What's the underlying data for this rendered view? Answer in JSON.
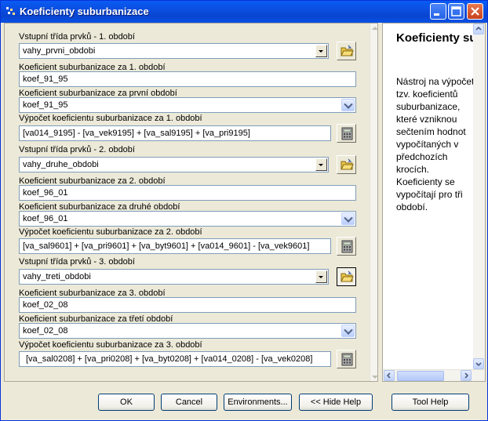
{
  "window": {
    "title": "Koeficienty suburbanizace"
  },
  "form": {
    "fields": [
      {
        "label": "Vstupní třída prvků - 1. období",
        "value": "vahy_prvni_obdobi",
        "type": "combo-folder"
      },
      {
        "label": "Koeficient suburbanizace za 1. období",
        "value": "koef_91_95",
        "type": "text"
      },
      {
        "label": "Koeficient suburbanizace za první období",
        "value": "koef_91_95",
        "type": "combo"
      },
      {
        "label": "Výpočet koeficientu suburbanizace za 1. období",
        "value": "[va014_9195] - [va_vek9195] + [va_sal9195] + [va_pri9195]",
        "type": "calc"
      },
      {
        "label": "Vstupní třída prvků - 2. období",
        "value": "vahy_druhe_obdobi",
        "type": "combo-folder"
      },
      {
        "label": "Koeficient suburbanizace za 2. období",
        "value": "koef_96_01",
        "type": "text"
      },
      {
        "label": "Koeficient suburbanizace za druhé období",
        "value": "koef_96_01",
        "type": "combo"
      },
      {
        "label": "Výpočet koeficientu suburbanizace za 2. období",
        "value": "[va_sal9601] + [va_pri9601] + [va_byt9601] + [va014_9601] - [va_vek9601]",
        "type": "calc"
      },
      {
        "label": "Vstupní třída prvků - 3. období",
        "value": "vahy_treti_obdobi",
        "type": "combo-folder"
      },
      {
        "label": "Koeficient suburbanizace za 3. období",
        "value": "koef_02_08",
        "type": "text"
      },
      {
        "label": "Koeficient suburbanizace za třetí období",
        "value": "koef_02_08",
        "type": "combo"
      },
      {
        "label": "Výpočet koeficientu suburbanizace za 3. období",
        "value": "[va_sal0208] + [va_pri0208] + [va_byt0208] + [va014_0208] - [va_vek0208]",
        "type": "calc"
      }
    ]
  },
  "help": {
    "title": "Koeficienty suburbaniza",
    "body": "Nástroj na výpočet tzv. koeficientů suburbanizace, které vzniknou sečtením hodnot vypočítaných v předchozích krocích. Koeficienty se vypočítají pro tři období."
  },
  "buttons": {
    "ok": "OK",
    "cancel": "Cancel",
    "environments": "Environments...",
    "hide_help": "<< Hide Help",
    "tool_help": "Tool Help"
  },
  "colors": {
    "titlebar": "#0a5cf5",
    "window_bg": "#ece9d8",
    "field_border": "#7f9db9"
  }
}
